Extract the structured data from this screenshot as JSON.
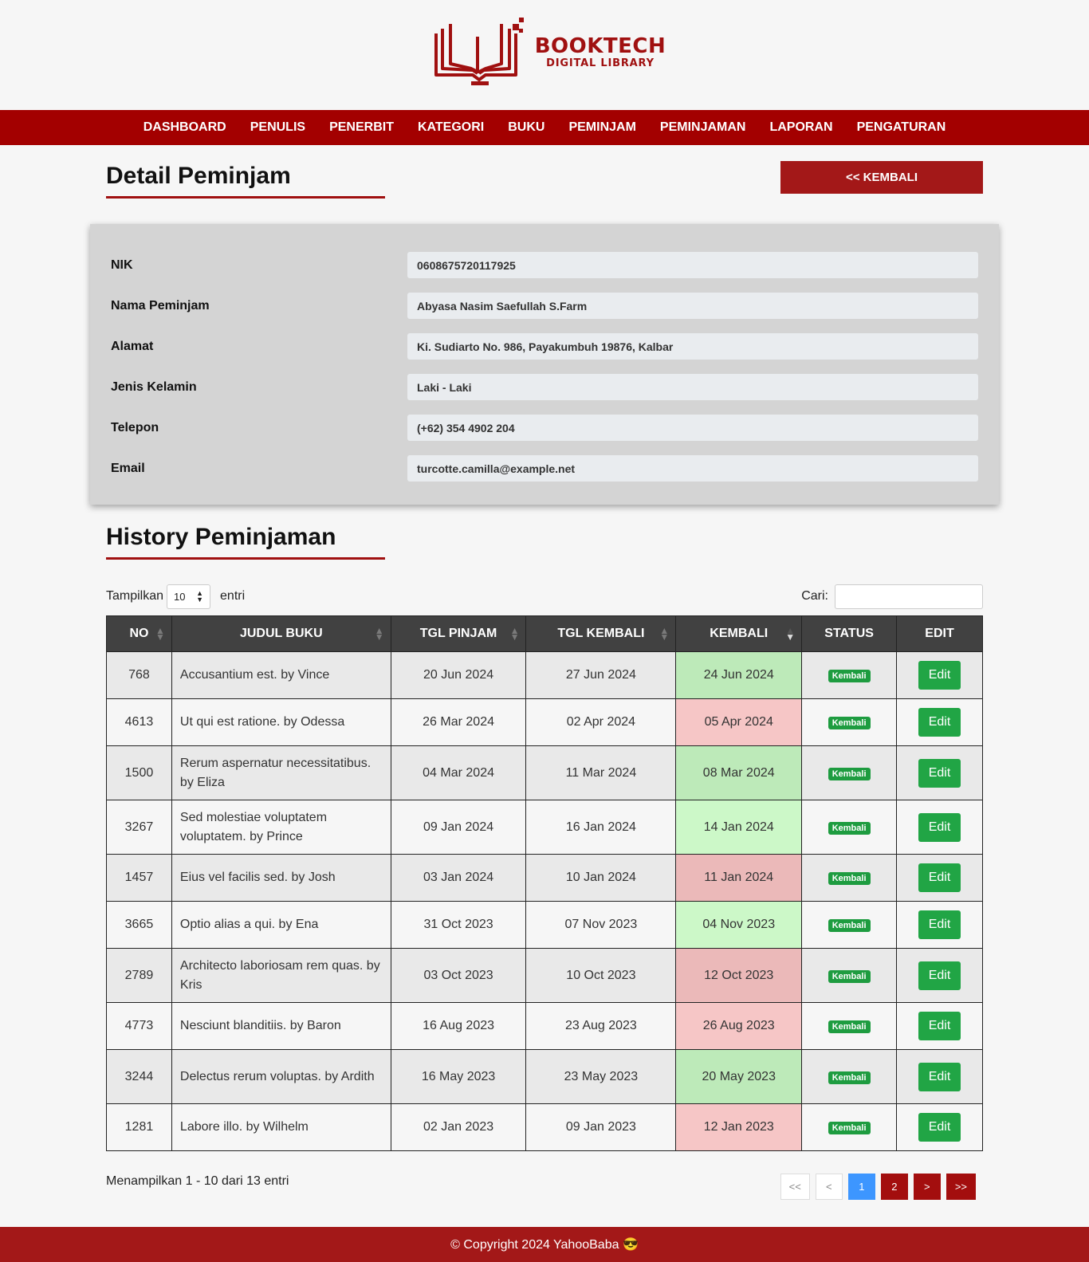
{
  "brand": {
    "title": "BOOKTECH",
    "subtitle": "DIGITAL LIBRARY",
    "color": "#a01010"
  },
  "nav": {
    "items": [
      "DASHBOARD",
      "PENULIS",
      "PENERBIT",
      "KATEGORI",
      "BUKU",
      "PEMINJAM",
      "PEMINJAMAN",
      "LAPORAN",
      "PENGATURAN"
    ]
  },
  "detail": {
    "title": "Detail Peminjam",
    "back_label": "<< KEMBALI",
    "fields": [
      {
        "label": "NIK",
        "value": "0608675720117925"
      },
      {
        "label": "Nama Peminjam",
        "value": "Abyasa Nasim Saefullah S.Farm"
      },
      {
        "label": "Alamat",
        "value": "Ki. Sudiarto No. 986, Payakumbuh 19876, Kalbar"
      },
      {
        "label": "Jenis Kelamin",
        "value": "Laki - Laki"
      },
      {
        "label": "Telepon",
        "value": "(+62) 354 4902 204"
      },
      {
        "label": "Email",
        "value": "turcotte.camilla@example.net"
      }
    ]
  },
  "history": {
    "title": "History Peminjaman",
    "show_label": "Tampilkan",
    "entries_value": "10",
    "entries_suffix": "entri",
    "search_label": "Cari:",
    "search_value": "",
    "columns": [
      "NO",
      "JUDUL BUKU",
      "TGL PINJAM",
      "TGL KEMBALI",
      "KEMBALI",
      "STATUS",
      "EDIT"
    ],
    "rows": [
      {
        "no": "768",
        "judul": "Accusantium est. by Vince",
        "pinjam": "20 Jun 2024",
        "tgl_kembali": "27 Jun 2024",
        "kembali": "24 Jun 2024",
        "kembali_color": "#bdeab9",
        "status": "Kembali",
        "edit": "Edit"
      },
      {
        "no": "4613",
        "judul": "Ut qui est ratione. by Odessa",
        "pinjam": "26 Mar 2024",
        "tgl_kembali": "02 Apr 2024",
        "kembali": "05 Apr 2024",
        "kembali_color": "#f6c6c6",
        "status": "Kembali",
        "edit": "Edit"
      },
      {
        "no": "1500",
        "judul": "Rerum aspernatur necessitatibus. by Eliza",
        "pinjam": "04 Mar 2024",
        "tgl_kembali": "11 Mar 2024",
        "kembali": "08 Mar 2024",
        "kembali_color": "#bdeab9",
        "status": "Kembali",
        "edit": "Edit"
      },
      {
        "no": "3267",
        "judul": "Sed molestiae voluptatem voluptatem. by Prince",
        "pinjam": "09 Jan 2024",
        "tgl_kembali": "16 Jan 2024",
        "kembali": "14 Jan 2024",
        "kembali_color": "#ccf8c8",
        "status": "Kembali",
        "edit": "Edit"
      },
      {
        "no": "1457",
        "judul": "Eius vel facilis sed. by Josh",
        "pinjam": "03 Jan 2024",
        "tgl_kembali": "10 Jan 2024",
        "kembali": "11 Jan 2024",
        "kembali_color": "#ebb9b9",
        "status": "Kembali",
        "edit": "Edit"
      },
      {
        "no": "3665",
        "judul": "Optio alias a qui. by Ena",
        "pinjam": "31 Oct 2023",
        "tgl_kembali": "07 Nov 2023",
        "kembali": "04 Nov 2023",
        "kembali_color": "#ccf8c8",
        "status": "Kembali",
        "edit": "Edit"
      },
      {
        "no": "2789",
        "judul": "Architecto laboriosam rem quas. by Kris",
        "pinjam": "03 Oct 2023",
        "tgl_kembali": "10 Oct 2023",
        "kembali": "12 Oct 2023",
        "kembali_color": "#ebb9b9",
        "status": "Kembali",
        "edit": "Edit"
      },
      {
        "no": "4773",
        "judul": "Nesciunt blanditiis. by Baron",
        "pinjam": "16 Aug 2023",
        "tgl_kembali": "23 Aug 2023",
        "kembali": "26 Aug 2023",
        "kembali_color": "#f6c6c6",
        "status": "Kembali",
        "edit": "Edit"
      },
      {
        "no": "3244",
        "judul": "Delectus rerum voluptas. by Ardith",
        "pinjam": "16 May 2023",
        "tgl_kembali": "23 May 2023",
        "kembali": "20 May 2023",
        "kembali_color": "#bdeab9",
        "status": "Kembali",
        "edit": "Edit"
      },
      {
        "no": "1281",
        "judul": "Labore illo. by Wilhelm",
        "pinjam": "02 Jan 2023",
        "tgl_kembali": "09 Jan 2023",
        "kembali": "12 Jan 2023",
        "kembali_color": "#f6c6c6",
        "status": "Kembali",
        "edit": "Edit"
      }
    ],
    "info": "Menampilkan 1 - 10 dari 13 entri",
    "pagination": {
      "first": "<<",
      "prev": "<",
      "pages": [
        "1",
        "2"
      ],
      "current": "1",
      "next": ">",
      "last": ">>"
    }
  },
  "footer": {
    "text": "© Copyright 2024 YahooBaba 😎"
  }
}
